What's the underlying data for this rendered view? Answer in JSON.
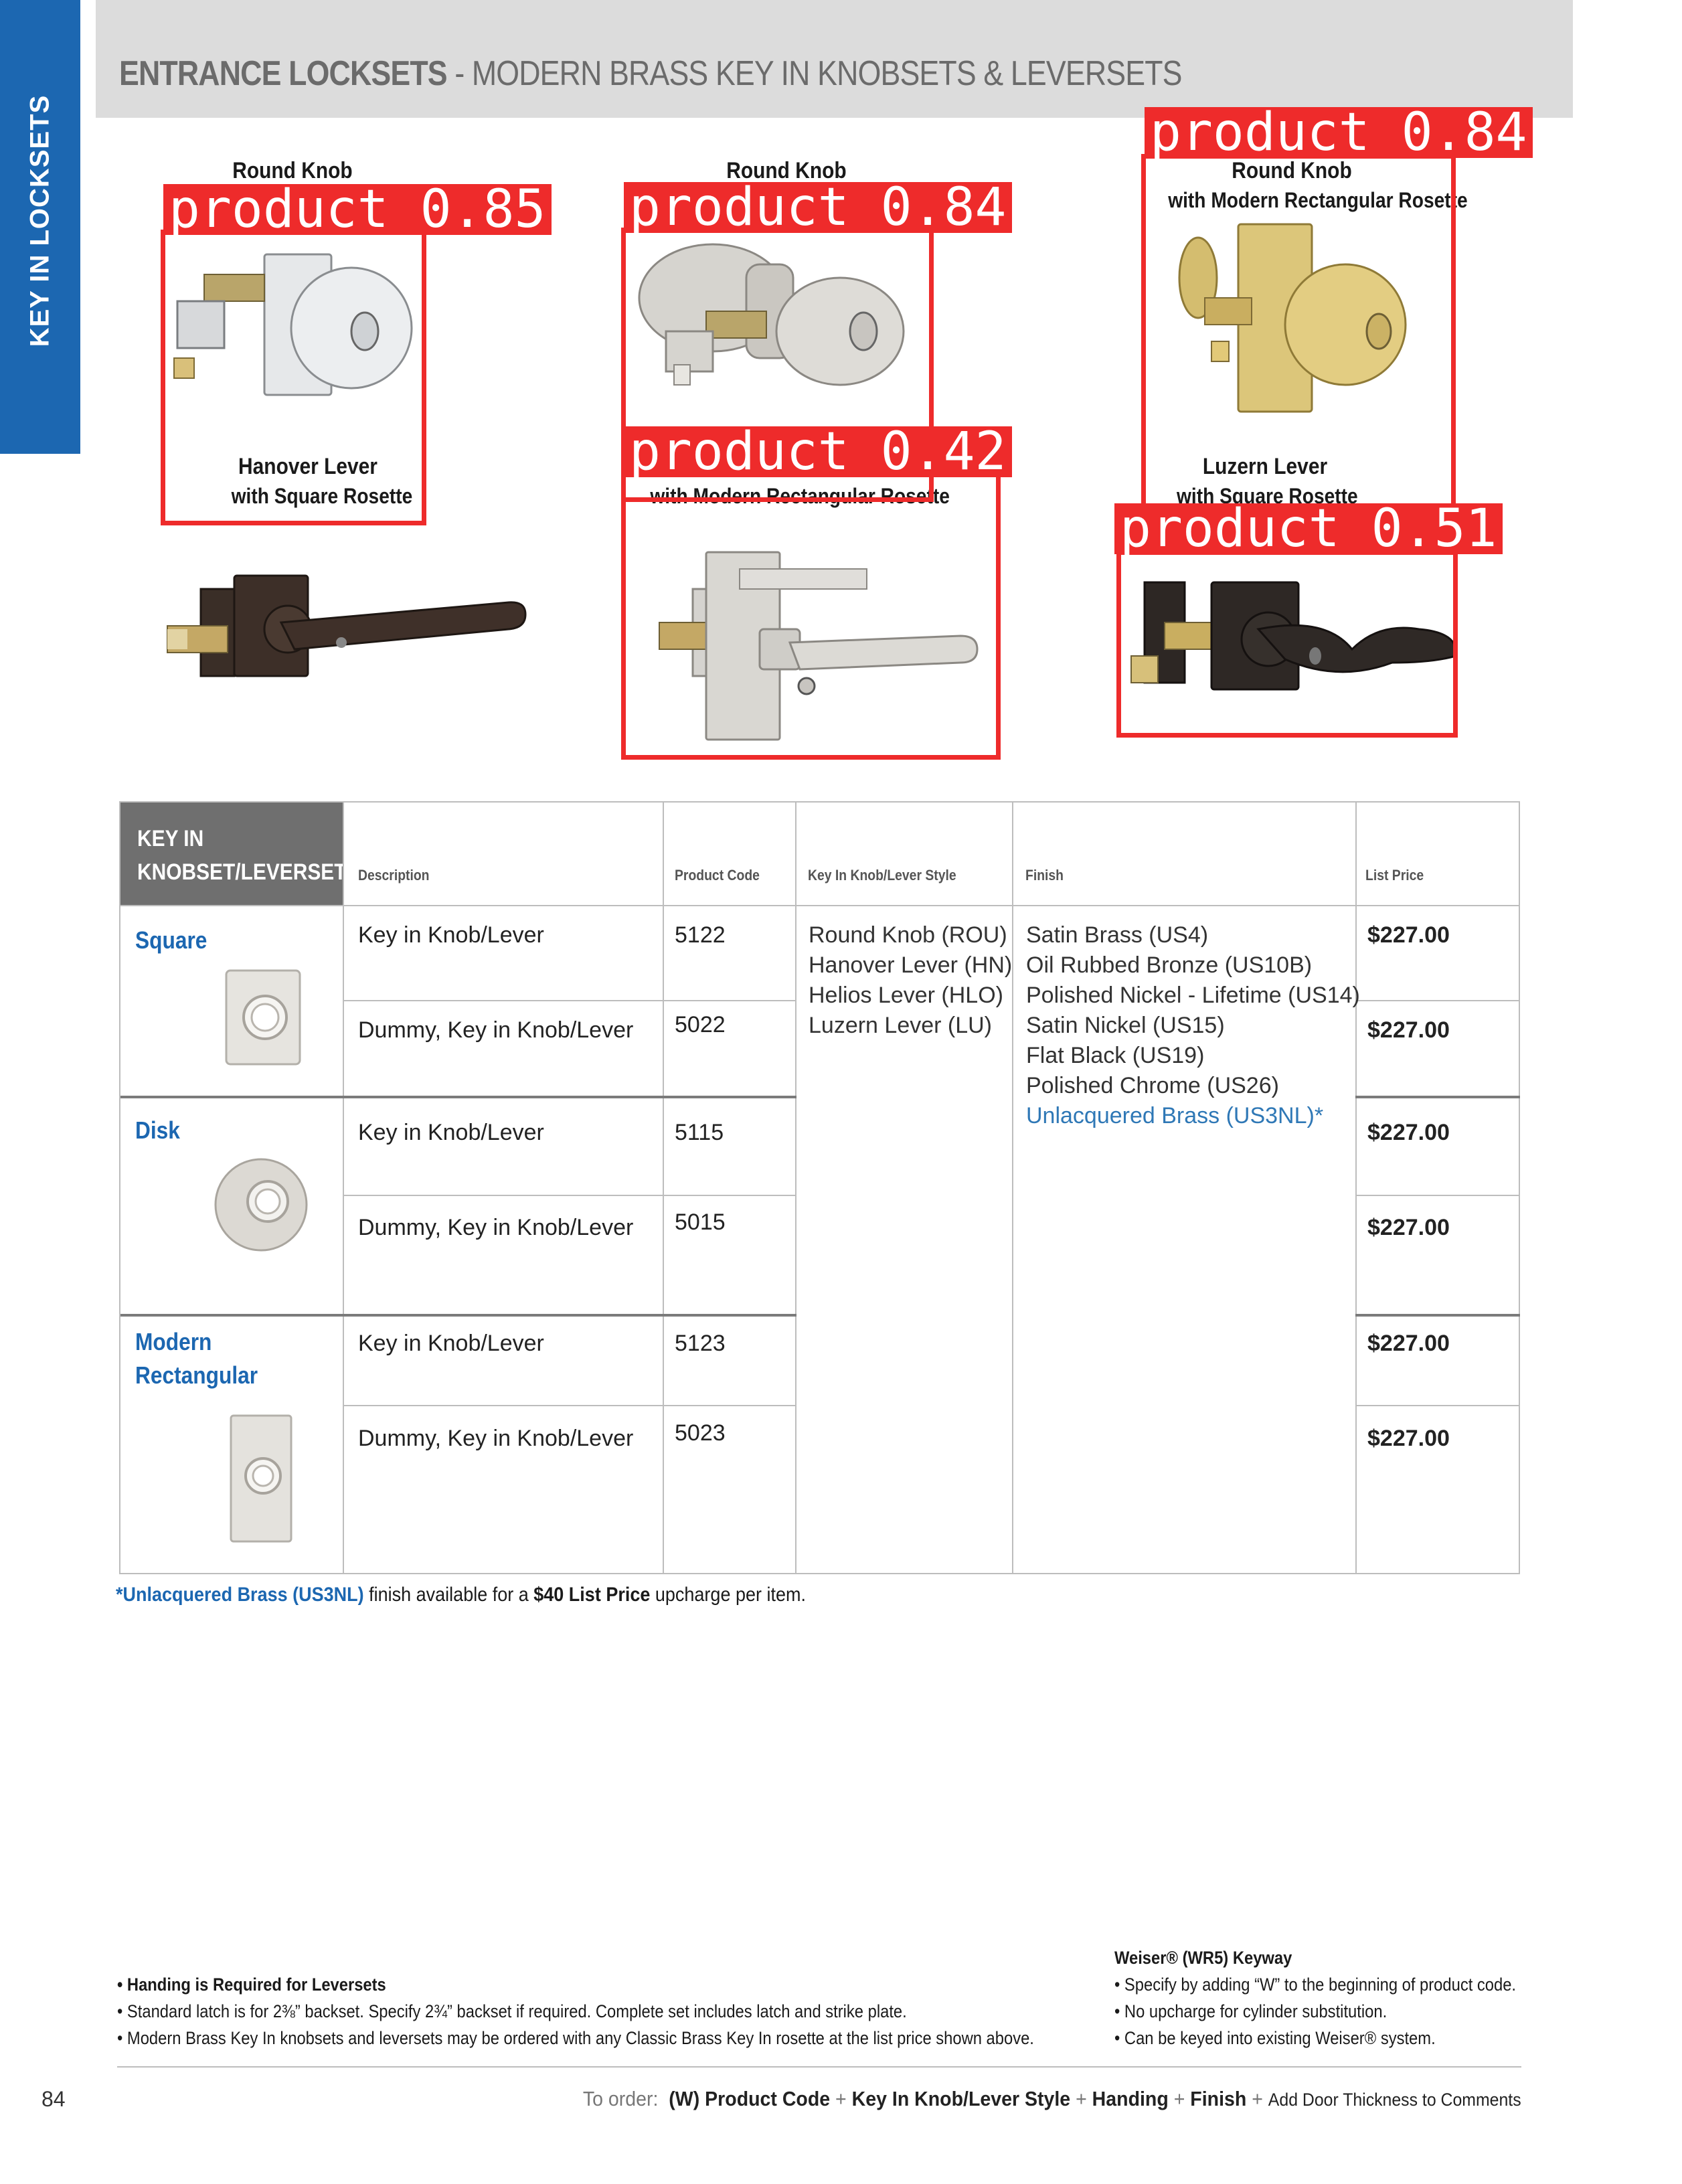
{
  "side_tab": {
    "label": "KEY IN LOCKSETS",
    "color": "#1c67b1"
  },
  "header": {
    "title_bold": "ENTRANCE LOCKSETS",
    "title_rest": " - MODERN BRASS KEY IN KNOBSETS & LEVERSETS"
  },
  "products": [
    {
      "name": "Round Knob",
      "sub": ""
    },
    {
      "name": "Round Knob",
      "sub": ""
    },
    {
      "name": "Round Knob",
      "sub": "with Modern Rectangular Rosette"
    },
    {
      "name": "Hanover Lever",
      "sub": "with Square Rosette"
    },
    {
      "name": "",
      "sub": "with Modern Rectangular Rosette"
    },
    {
      "name": "Luzern Lever",
      "sub": "with Square Rosette"
    }
  ],
  "detections": [
    {
      "label": "product 0.85"
    },
    {
      "label": "product 0.84"
    },
    {
      "label": "product 0.84"
    },
    {
      "label": "product 0.42"
    },
    {
      "label": "product 0.51"
    }
  ],
  "table": {
    "corner_line1": "KEY IN",
    "corner_line2": "KNOBSET/LEVERSET",
    "headers": {
      "description": "Description",
      "product_code": "Product Code",
      "style": "Key In Knob/Lever Style",
      "finish": "Finish",
      "list_price": "List Price"
    },
    "groups": [
      {
        "name": "Square"
      },
      {
        "name": "Disk"
      },
      {
        "name_line1": "Modern",
        "name_line2": "Rectangular"
      }
    ],
    "rows": [
      {
        "description": "Key in Knob/Lever",
        "code": "5122",
        "price": "$227.00"
      },
      {
        "description": "Dummy, Key in Knob/Lever",
        "code": "5022",
        "price": "$227.00"
      },
      {
        "description": "Key in Knob/Lever",
        "code": "5115",
        "price": "$227.00"
      },
      {
        "description": "Dummy, Key in Knob/Lever",
        "code": "5015",
        "price": "$227.00"
      },
      {
        "description": "Key in Knob/Lever",
        "code": "5123",
        "price": "$227.00"
      },
      {
        "description": "Dummy, Key in Knob/Lever",
        "code": "5023",
        "price": "$227.00"
      }
    ],
    "styles": [
      "Round Knob (ROU)",
      "Hanover Lever (HN)",
      "Helios Lever (HLO)",
      "Luzern Lever (LU)"
    ],
    "finishes": [
      "Satin Brass (US4)",
      "Oil Rubbed Bronze (US10B)",
      "Polished Nickel - Lifetime (US14)",
      "Satin Nickel (US15)",
      "Flat Black (US19)",
      "Polished Chrome (US26)",
      "Unlacquered Brass (US3NL)*"
    ]
  },
  "footnote": {
    "asterisk": "*",
    "finish": "Unlacquered Brass (US3NL)",
    "text1": " finish available for a ",
    "bold": "$40 List Price",
    "text2": " upcharge per item."
  },
  "notes_left": [
    {
      "text": "• Handing is Required for Leversets",
      "bold": true
    },
    {
      "text": "• Standard latch is for 2⅜” backset. Specify 2¾” backset if required. Complete set includes latch and strike plate.",
      "bold": false
    },
    {
      "text": "• Modern Brass Key In knobsets and leversets may be ordered with any Classic Brass Key In rosette at the list price shown above.",
      "bold": false
    }
  ],
  "notes_right": {
    "title": "Weiser® (WR5) Keyway",
    "items": [
      "• Specify by adding “W” to the beginning of product code.",
      "• No upcharge for cylinder substitution.",
      "• Can be keyed into existing Weiser® system."
    ]
  },
  "footer": {
    "page_number": "84",
    "order_prefix": "To order:",
    "order_w": "(W)",
    "order_code": "Product Code",
    "plus": "+",
    "order_style": "Key In Knob/Lever Style",
    "order_handing": "Handing",
    "order_finish": "Finish",
    "order_comment": "Add Door Thickness to Comments"
  }
}
